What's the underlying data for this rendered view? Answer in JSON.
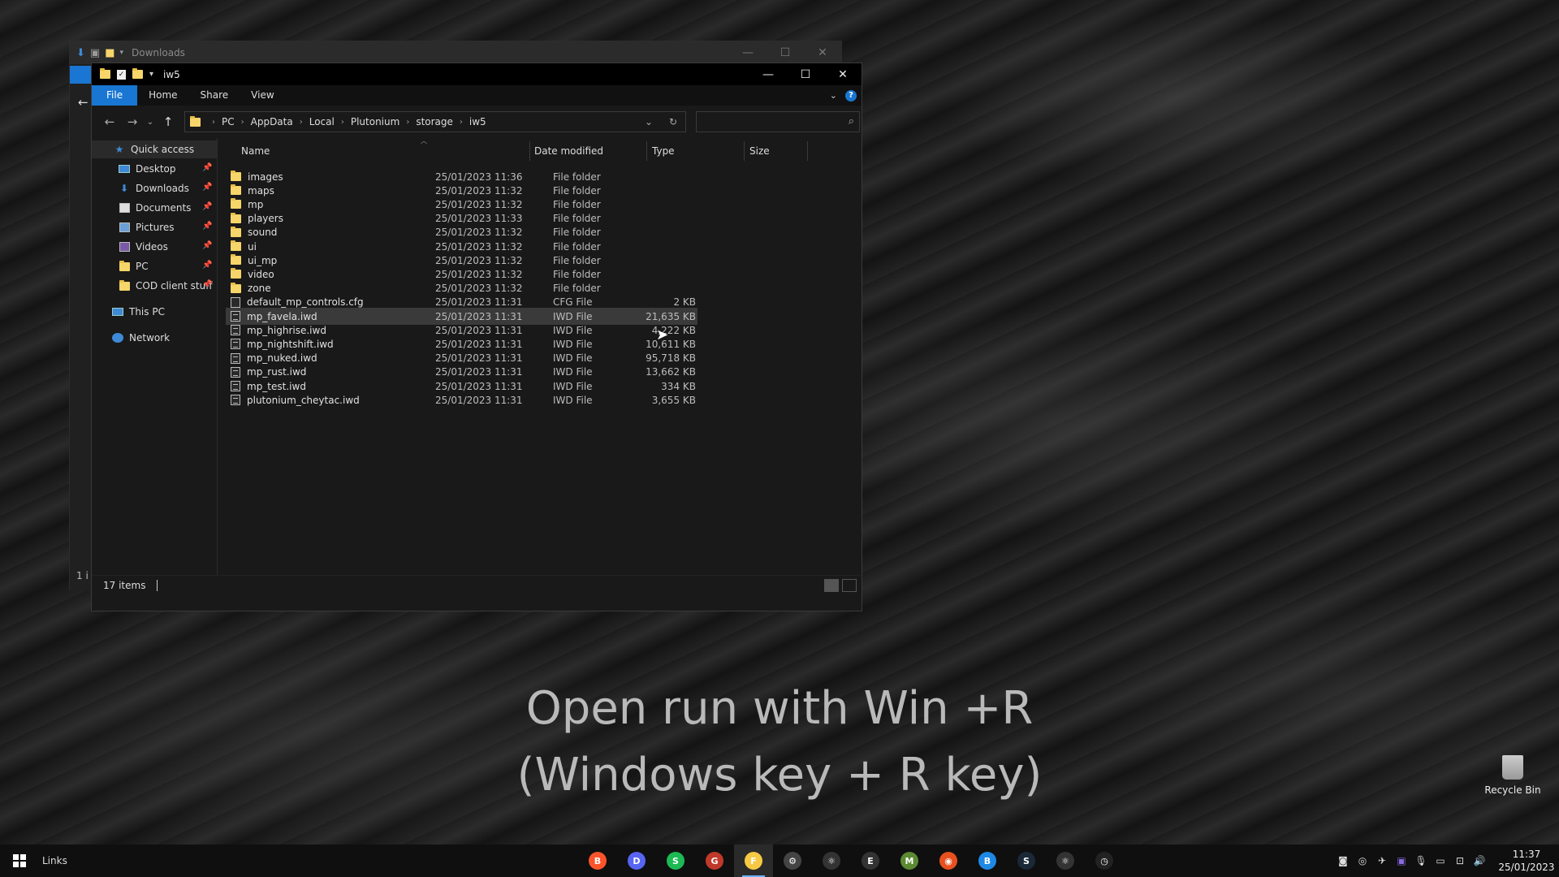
{
  "back_window": {
    "title": "Downloads",
    "status": "1 i"
  },
  "window": {
    "title": "iw5",
    "controls": {
      "minimize": "—",
      "maximize": "☐",
      "close": "✕"
    }
  },
  "ribbon": {
    "tabs": [
      "File",
      "Home",
      "Share",
      "View"
    ]
  },
  "address": {
    "crumbs": [
      "PC",
      "AppData",
      "Local",
      "Plutonium",
      "storage",
      "iw5"
    ]
  },
  "search": {
    "placeholder": ""
  },
  "sidebar": {
    "quick_access": "Quick access",
    "pinned": [
      "Desktop",
      "Downloads",
      "Documents",
      "Pictures",
      "Videos",
      "PC",
      "COD client stuff"
    ],
    "this_pc": "This PC",
    "network": "Network"
  },
  "columns": {
    "name": "Name",
    "date": "Date modified",
    "type": "Type",
    "size": "Size"
  },
  "files": [
    {
      "name": "images",
      "date": "25/01/2023 11:36",
      "type": "File folder",
      "size": "",
      "kind": "folder"
    },
    {
      "name": "maps",
      "date": "25/01/2023 11:32",
      "type": "File folder",
      "size": "",
      "kind": "folder"
    },
    {
      "name": "mp",
      "date": "25/01/2023 11:32",
      "type": "File folder",
      "size": "",
      "kind": "folder"
    },
    {
      "name": "players",
      "date": "25/01/2023 11:33",
      "type": "File folder",
      "size": "",
      "kind": "folder"
    },
    {
      "name": "sound",
      "date": "25/01/2023 11:32",
      "type": "File folder",
      "size": "",
      "kind": "folder"
    },
    {
      "name": "ui",
      "date": "25/01/2023 11:32",
      "type": "File folder",
      "size": "",
      "kind": "folder"
    },
    {
      "name": "ui_mp",
      "date": "25/01/2023 11:32",
      "type": "File folder",
      "size": "",
      "kind": "folder"
    },
    {
      "name": "video",
      "date": "25/01/2023 11:32",
      "type": "File folder",
      "size": "",
      "kind": "folder"
    },
    {
      "name": "zone",
      "date": "25/01/2023 11:32",
      "type": "File folder",
      "size": "",
      "kind": "folder"
    },
    {
      "name": "default_mp_controls.cfg",
      "date": "25/01/2023 11:31",
      "type": "CFG File",
      "size": "2 KB",
      "kind": "cfg"
    },
    {
      "name": "mp_favela.iwd",
      "date": "25/01/2023 11:31",
      "type": "IWD File",
      "size": "21,635 KB",
      "kind": "iwd",
      "selected": true
    },
    {
      "name": "mp_highrise.iwd",
      "date": "25/01/2023 11:31",
      "type": "IWD File",
      "size": "4,222 KB",
      "kind": "iwd"
    },
    {
      "name": "mp_nightshift.iwd",
      "date": "25/01/2023 11:31",
      "type": "IWD File",
      "size": "10,611 KB",
      "kind": "iwd"
    },
    {
      "name": "mp_nuked.iwd",
      "date": "25/01/2023 11:31",
      "type": "IWD File",
      "size": "95,718 KB",
      "kind": "iwd"
    },
    {
      "name": "mp_rust.iwd",
      "date": "25/01/2023 11:31",
      "type": "IWD File",
      "size": "13,662 KB",
      "kind": "iwd"
    },
    {
      "name": "mp_test.iwd",
      "date": "25/01/2023 11:31",
      "type": "IWD File",
      "size": "334 KB",
      "kind": "iwd"
    },
    {
      "name": "plutonium_cheytac.iwd",
      "date": "25/01/2023 11:31",
      "type": "IWD File",
      "size": "3,655 KB",
      "kind": "iwd"
    }
  ],
  "status": {
    "count": "17 items"
  },
  "overlay": {
    "line1": "Open run with Win +R",
    "line2": "(Windows key + R key)"
  },
  "desktop": {
    "recycle_bin": "Recycle Bin"
  },
  "taskbar": {
    "links": "Links",
    "apps": [
      {
        "name": "brave-icon",
        "color": "#fb542b",
        "glyph": "B"
      },
      {
        "name": "discord-icon",
        "color": "#5865f2",
        "glyph": "D"
      },
      {
        "name": "spotify-icon",
        "color": "#1db954",
        "glyph": "S"
      },
      {
        "name": "app-icon",
        "color": "#c0392b",
        "glyph": "G"
      },
      {
        "name": "file-explorer-icon",
        "color": "#f6c945",
        "glyph": "F",
        "active": true
      },
      {
        "name": "settings-icon",
        "color": "#444444",
        "glyph": "⚙"
      },
      {
        "name": "react-icon",
        "color": "#333333",
        "glyph": "⚛"
      },
      {
        "name": "epic-games-icon",
        "color": "#333333",
        "glyph": "E"
      },
      {
        "name": "minecraft-icon",
        "color": "#5b8a32",
        "glyph": "M"
      },
      {
        "name": "location-icon",
        "color": "#e8501f",
        "glyph": "◉"
      },
      {
        "name": "browser-icon",
        "color": "#1e88e5",
        "glyph": "B"
      },
      {
        "name": "steam-icon",
        "color": "#1b2838",
        "glyph": "S"
      },
      {
        "name": "electron-icon",
        "color": "#333333",
        "glyph": "⚛"
      },
      {
        "name": "clock-app-icon",
        "color": "#222222",
        "glyph": "◷"
      }
    ],
    "time": "11:37",
    "date": "25/01/2023"
  }
}
